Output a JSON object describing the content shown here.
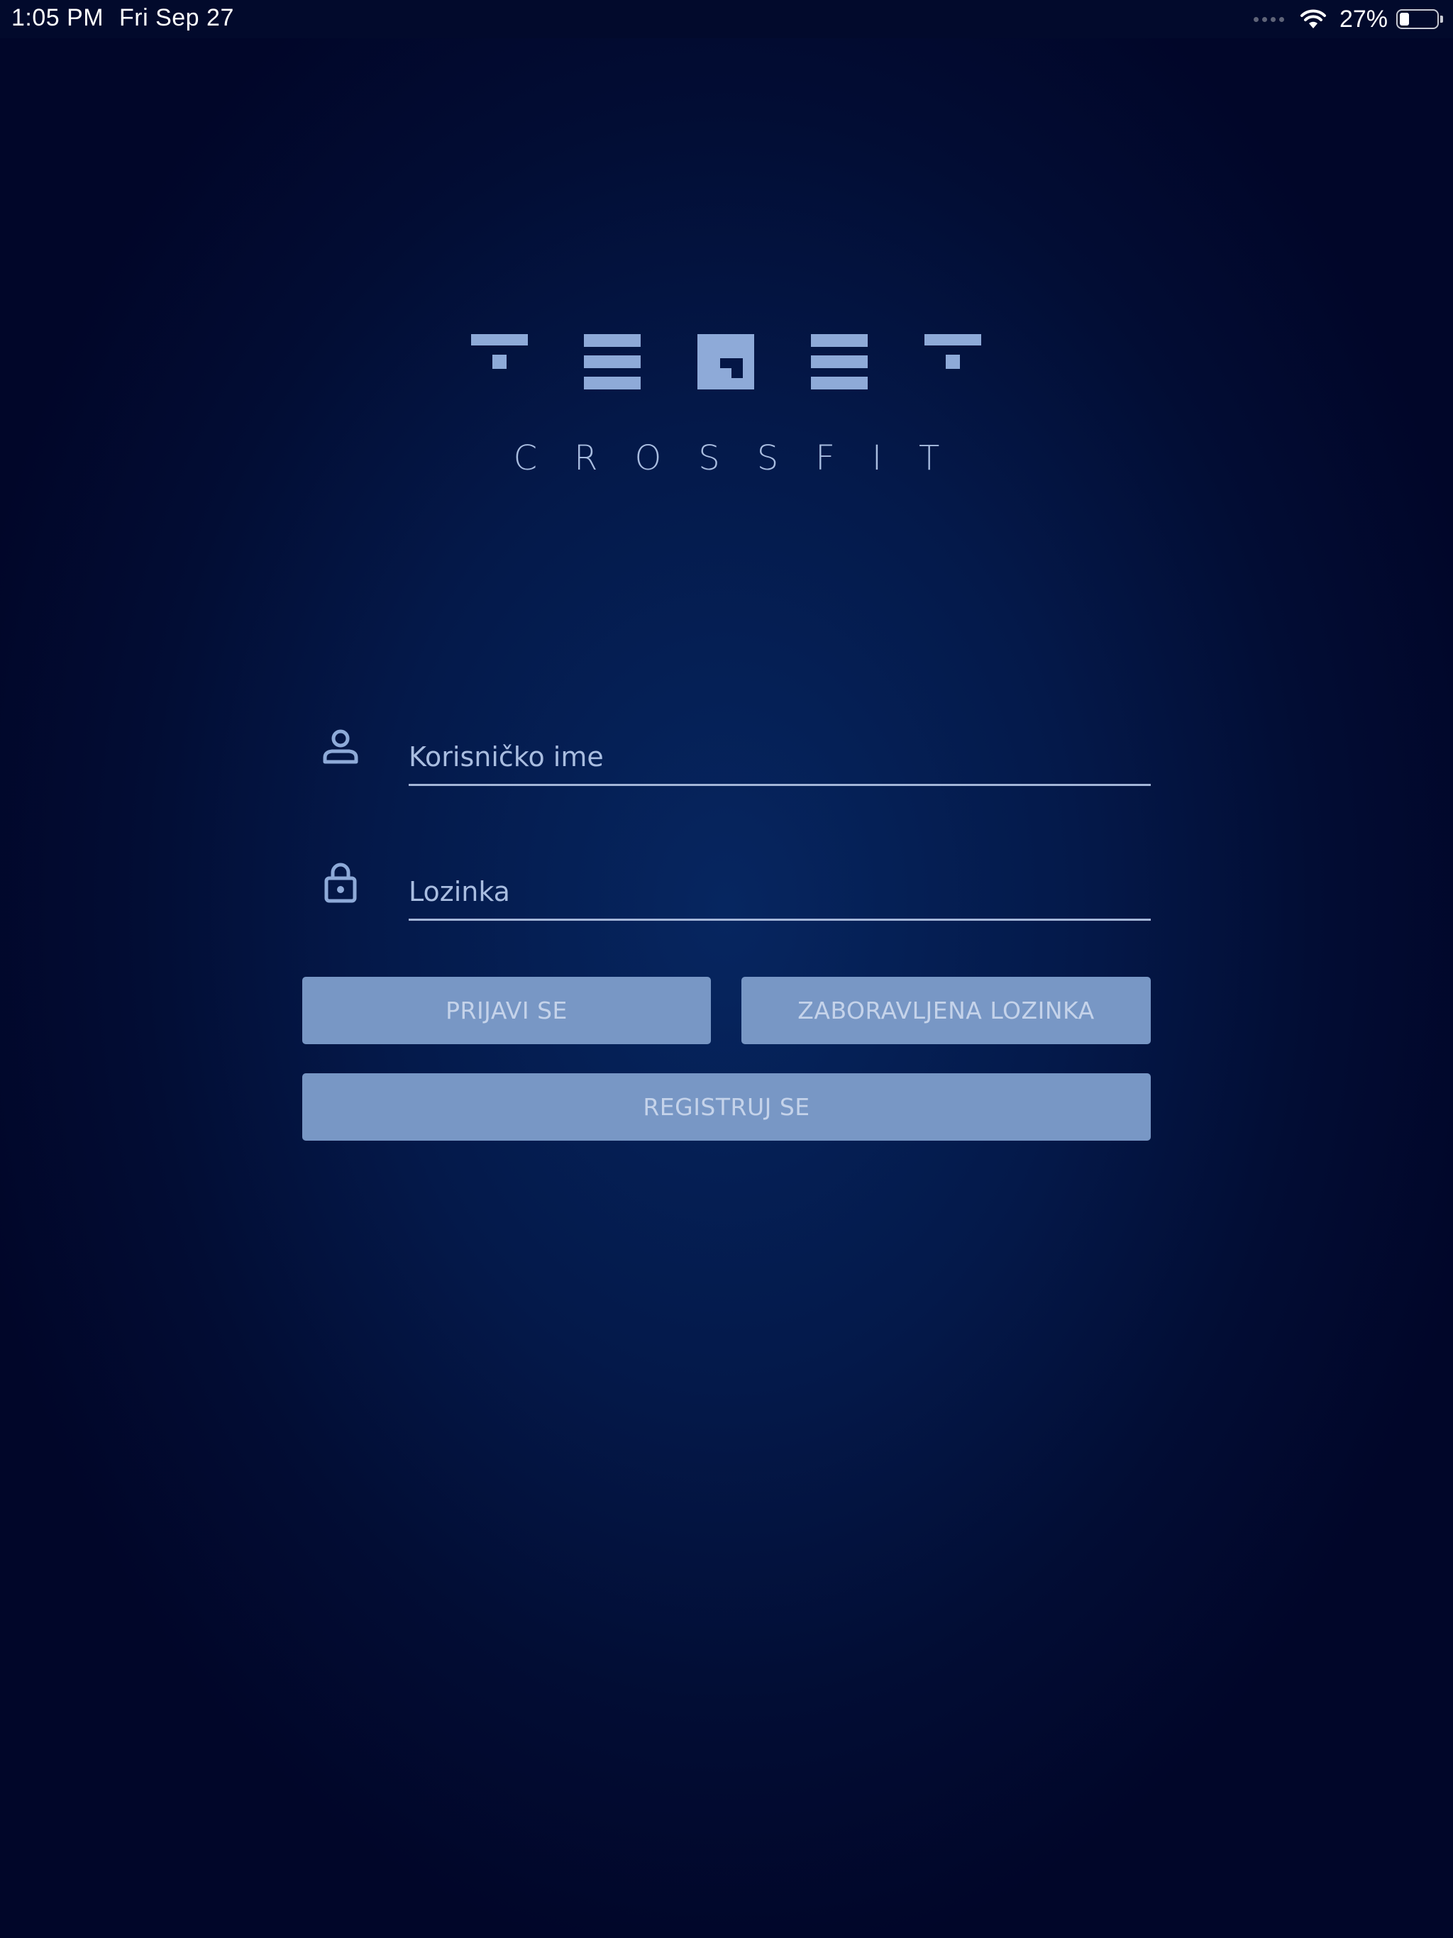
{
  "status_bar": {
    "time": "1:05 PM",
    "date": "Fri Sep 27",
    "battery_percent": "27%",
    "battery_level": 0.27,
    "icons": [
      "signal-dots-icon",
      "wifi-icon",
      "battery-icon"
    ]
  },
  "logo": {
    "wordmark": "TEGET",
    "subtitle": "CROSSFIT"
  },
  "form": {
    "username": {
      "placeholder": "Korisničko ime",
      "value": "",
      "icon": "person-icon"
    },
    "password": {
      "placeholder": "Lozinka",
      "value": "",
      "icon": "lock-icon"
    }
  },
  "buttons": {
    "login": "PRIJAVI SE",
    "forgot_password": "ZABORAVLJENA LOZINKA",
    "register": "REGISTRUJ SE"
  },
  "colors": {
    "background": "#04194a",
    "accent": "#a9bde0",
    "button": "#7897c5",
    "button_text": "#c5d3ea"
  }
}
